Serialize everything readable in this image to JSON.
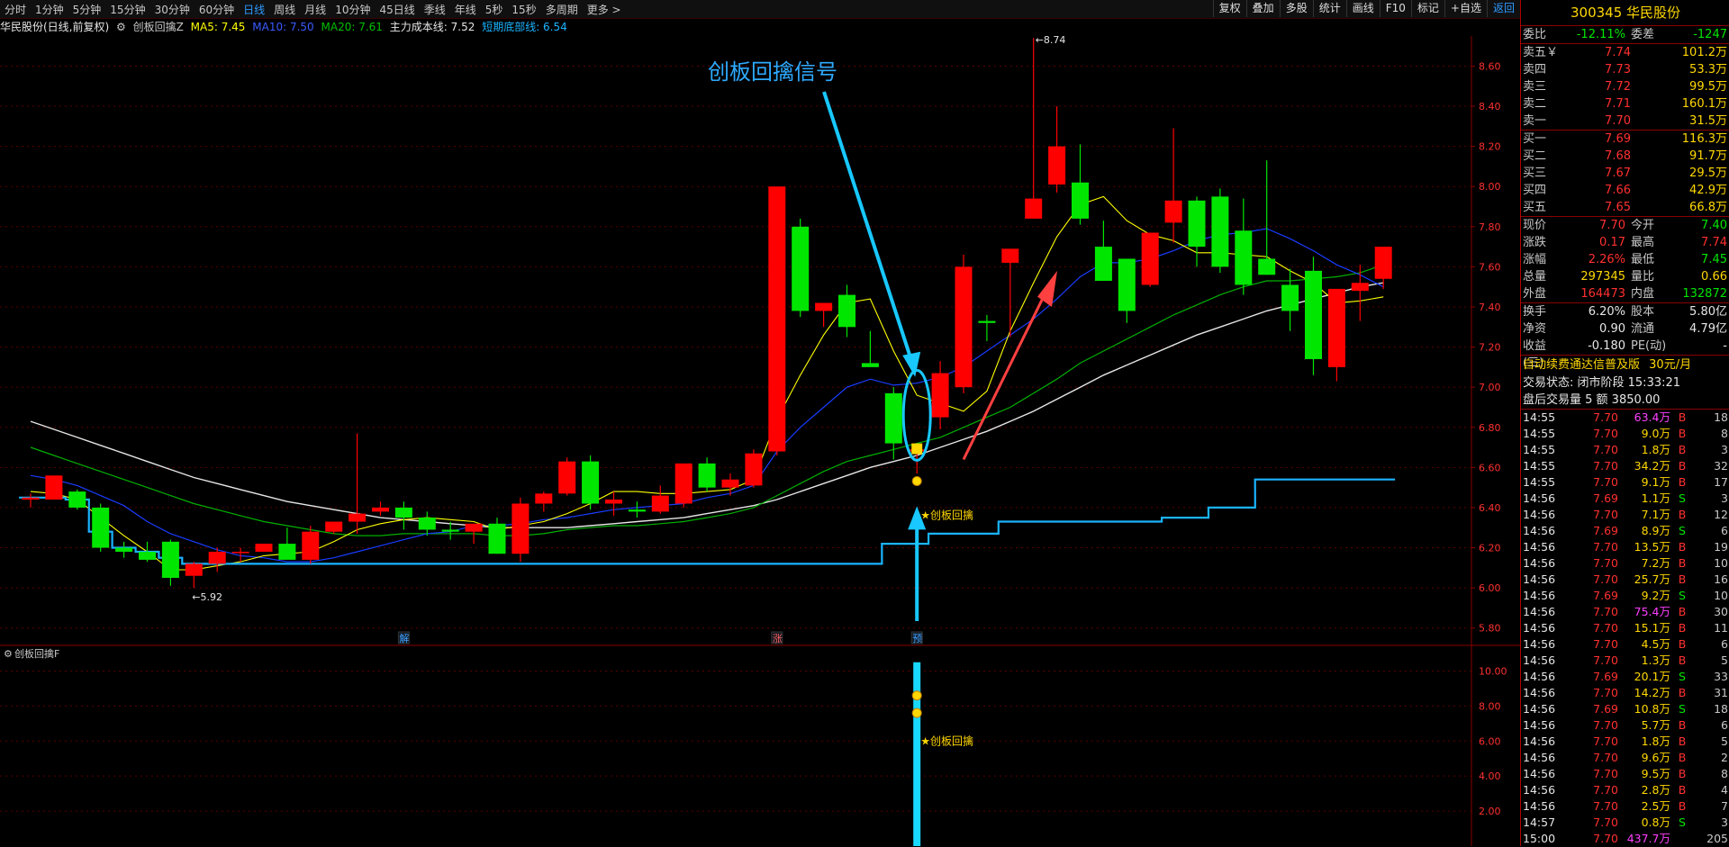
{
  "toolbar": {
    "periods": [
      "分时",
      "1分钟",
      "5分钟",
      "15分钟",
      "30分钟",
      "60分钟",
      "日线",
      "周线",
      "月线",
      "10分钟",
      "45日线",
      "季线",
      "年线",
      "5秒",
      "15秒",
      "多周期",
      "更多 >"
    ],
    "active_period": "日线",
    "right_buttons": [
      "复权",
      "叠加",
      "多股",
      "统计",
      "画线",
      "F10",
      "标记",
      "+自选",
      "返回"
    ],
    "active_right": "返回"
  },
  "info": {
    "stock": "华民股份(日线,前复权)",
    "formula": "创板回擒Z",
    "ma5": "MA5: 7.45",
    "ma10": "MA10: 7.50",
    "ma20": "MA20: 7.61",
    "cost": "主力成本线: 7.52",
    "support": "短期底部线: 6.54"
  },
  "annotation": {
    "signal_title": "创板回擒信号",
    "marker_label": "★创板回擒",
    "lower_marker_label": "★创板回擒",
    "hi_label": "8.74",
    "lo_label": "5.92",
    "bottom_tags": [
      "解",
      "涨",
      "预"
    ]
  },
  "lower_panel": {
    "title": "创板回擒F"
  },
  "colors": {
    "up": "#ff0000",
    "down": "#00e600",
    "ma5": "#ffff00",
    "ma10": "#1a3cff",
    "ma20": "#00b000",
    "cost": "#e6e6e6",
    "support": "#1ab4ff",
    "signal": "#18c8ff",
    "arrow_red": "#ff4040"
  },
  "chart_data": {
    "type": "candlestick",
    "ylim": [
      5.7,
      8.75
    ],
    "yticks": [
      "8.60",
      "8.40",
      "8.20",
      "8.00",
      "7.80",
      "7.60",
      "7.40",
      "7.20",
      "7.00",
      "6.80",
      "6.60",
      "6.40",
      "6.20",
      "6.00",
      "5.80"
    ],
    "lower_ylim": [
      0,
      11
    ],
    "lower_yticks": [
      "10.00",
      "8.00",
      "6.00",
      "4.00",
      "2.00"
    ],
    "candles": [
      [
        6.44,
        6.47,
        6.4,
        6.45
      ],
      [
        6.44,
        6.53,
        6.48,
        6.56
      ],
      [
        6.48,
        6.49,
        6.39,
        6.4
      ],
      [
        6.4,
        6.42,
        6.18,
        6.2
      ],
      [
        6.2,
        6.23,
        6.15,
        6.18
      ],
      [
        6.18,
        6.23,
        6.13,
        6.14
      ],
      [
        6.23,
        6.24,
        6.01,
        6.05
      ],
      [
        6.06,
        6.13,
        6.0,
        6.12
      ],
      [
        6.12,
        6.2,
        6.08,
        6.18
      ],
      [
        6.18,
        6.2,
        6.13,
        6.18
      ],
      [
        6.18,
        6.22,
        6.18,
        6.22
      ],
      [
        6.22,
        6.3,
        6.18,
        6.14
      ],
      [
        6.14,
        6.31,
        6.12,
        6.28
      ],
      [
        6.28,
        6.32,
        6.27,
        6.33
      ],
      [
        6.33,
        6.77,
        6.27,
        6.37
      ],
      [
        6.38,
        6.43,
        6.36,
        6.4
      ],
      [
        6.4,
        6.43,
        6.29,
        6.35
      ],
      [
        6.35,
        6.38,
        6.26,
        6.29
      ],
      [
        6.29,
        6.33,
        6.24,
        6.28
      ],
      [
        6.28,
        6.3,
        6.22,
        6.32
      ],
      [
        6.32,
        6.35,
        6.17,
        6.17
      ],
      [
        6.17,
        6.45,
        6.13,
        6.42
      ],
      [
        6.42,
        6.48,
        6.38,
        6.47
      ],
      [
        6.47,
        6.65,
        6.46,
        6.63
      ],
      [
        6.63,
        6.66,
        6.39,
        6.42
      ],
      [
        6.42,
        6.48,
        6.36,
        6.44
      ],
      [
        6.39,
        6.43,
        6.35,
        6.38
      ],
      [
        6.38,
        6.51,
        6.37,
        6.46
      ],
      [
        6.42,
        6.6,
        6.4,
        6.62
      ],
      [
        6.62,
        6.65,
        6.48,
        6.5
      ],
      [
        6.5,
        6.57,
        6.46,
        6.54
      ],
      [
        6.51,
        6.69,
        6.5,
        6.67
      ],
      [
        6.68,
        8.0,
        6.66,
        8.0
      ],
      [
        7.8,
        7.84,
        7.35,
        7.38
      ],
      [
        7.38,
        7.42,
        7.3,
        7.42
      ],
      [
        7.46,
        7.51,
        7.25,
        7.3
      ],
      [
        7.12,
        7.28,
        7.12,
        7.1
      ],
      [
        6.97,
        7.0,
        6.64,
        6.72
      ],
      [
        6.68,
        6.68,
        6.57,
        6.69
      ],
      [
        6.85,
        7.13,
        6.79,
        7.07
      ],
      [
        7.0,
        7.66,
        6.97,
        7.6
      ],
      [
        7.33,
        7.36,
        7.23,
        7.32
      ],
      [
        7.62,
        7.69,
        7.25,
        7.69
      ],
      [
        7.84,
        8.74,
        7.84,
        7.94
      ],
      [
        8.01,
        8.4,
        7.97,
        8.2
      ],
      [
        8.02,
        8.21,
        7.81,
        7.84
      ],
      [
        7.7,
        7.83,
        7.55,
        7.53
      ],
      [
        7.64,
        7.64,
        7.32,
        7.38
      ],
      [
        7.51,
        7.77,
        7.5,
        7.77
      ],
      [
        7.82,
        8.29,
        7.72,
        7.93
      ],
      [
        7.93,
        7.95,
        7.6,
        7.7
      ],
      [
        7.95,
        7.99,
        7.57,
        7.6
      ],
      [
        7.78,
        7.94,
        7.46,
        7.51
      ],
      [
        7.64,
        8.13,
        7.56,
        7.56
      ],
      [
        7.51,
        7.59,
        7.28,
        7.38
      ],
      [
        7.58,
        7.65,
        7.06,
        7.14
      ],
      [
        7.1,
        7.49,
        7.03,
        7.49
      ],
      [
        7.48,
        7.61,
        7.33,
        7.52
      ],
      [
        7.54,
        7.62,
        7.49,
        7.7
      ]
    ],
    "ma5": [
      6.48,
      6.47,
      6.44,
      6.35,
      6.26,
      6.18,
      6.09,
      6.09,
      6.11,
      6.13,
      6.16,
      6.17,
      6.18,
      6.23,
      6.29,
      6.32,
      6.34,
      6.35,
      6.34,
      6.33,
      6.29,
      6.31,
      6.33,
      6.37,
      6.42,
      6.48,
      6.48,
      6.47,
      6.47,
      6.48,
      6.49,
      6.54,
      6.84,
      7.06,
      7.26,
      7.42,
      7.44,
      7.18,
      6.96,
      6.92,
      6.88,
      6.98,
      7.28,
      7.52,
      7.75,
      7.91,
      7.95,
      7.83,
      7.76,
      7.73,
      7.67,
      7.67,
      7.66,
      7.65,
      7.58,
      7.52,
      7.42,
      7.43,
      7.45
    ],
    "ma10": [
      6.56,
      6.54,
      6.51,
      6.46,
      6.41,
      6.33,
      6.27,
      6.23,
      6.19,
      6.16,
      6.15,
      6.13,
      6.13,
      6.15,
      6.18,
      6.21,
      6.24,
      6.27,
      6.28,
      6.31,
      6.31,
      6.32,
      6.34,
      6.35,
      6.37,
      6.39,
      6.4,
      6.41,
      6.42,
      6.45,
      6.47,
      6.51,
      6.68,
      6.8,
      6.9,
      7.0,
      7.04,
      7.01,
      7.02,
      7.05,
      7.1,
      7.18,
      7.26,
      7.34,
      7.44,
      7.55,
      7.62,
      7.62,
      7.64,
      7.68,
      7.73,
      7.76,
      7.77,
      7.79,
      7.74,
      7.68,
      7.61,
      7.56,
      7.5
    ],
    "ma20": [
      6.7,
      6.66,
      6.62,
      6.58,
      6.54,
      6.5,
      6.46,
      6.42,
      6.39,
      6.36,
      6.33,
      6.31,
      6.29,
      6.27,
      6.26,
      6.26,
      6.27,
      6.27,
      6.27,
      6.27,
      6.26,
      6.26,
      6.27,
      6.29,
      6.3,
      6.31,
      6.31,
      6.32,
      6.33,
      6.35,
      6.37,
      6.4,
      6.46,
      6.52,
      6.58,
      6.63,
      6.66,
      6.69,
      6.72,
      6.75,
      6.8,
      6.85,
      6.9,
      6.97,
      7.04,
      7.12,
      7.18,
      7.24,
      7.3,
      7.36,
      7.41,
      7.46,
      7.5,
      7.53,
      7.53,
      7.54,
      7.55,
      7.57,
      7.61
    ],
    "cost": [
      6.83,
      6.79,
      6.75,
      6.71,
      6.67,
      6.63,
      6.59,
      6.55,
      6.52,
      6.49,
      6.46,
      6.43,
      6.41,
      6.39,
      6.37,
      6.35,
      6.34,
      6.33,
      6.32,
      6.31,
      6.3,
      6.3,
      6.3,
      6.3,
      6.31,
      6.32,
      6.33,
      6.34,
      6.35,
      6.37,
      6.39,
      6.41,
      6.44,
      6.48,
      6.52,
      6.56,
      6.6,
      6.63,
      6.66,
      6.7,
      6.74,
      6.78,
      6.83,
      6.88,
      6.94,
      7.0,
      7.06,
      7.11,
      7.16,
      7.21,
      7.26,
      7.3,
      7.34,
      7.38,
      7.41,
      7.44,
      7.47,
      7.5,
      7.52
    ],
    "support": [
      6.45,
      6.45,
      6.44,
      6.28,
      6.2,
      6.18,
      6.15,
      6.12,
      6.12,
      6.12,
      6.12,
      6.12,
      6.12,
      6.12,
      6.12,
      6.12,
      6.12,
      6.12,
      6.12,
      6.12,
      6.12,
      6.12,
      6.12,
      6.12,
      6.12,
      6.12,
      6.12,
      6.12,
      6.12,
      6.12,
      6.12,
      6.12,
      6.12,
      6.12,
      6.12,
      6.12,
      6.12,
      6.22,
      6.22,
      6.27,
      6.27,
      6.27,
      6.33,
      6.33,
      6.33,
      6.33,
      6.33,
      6.33,
      6.33,
      6.35,
      6.35,
      6.4,
      6.4,
      6.54,
      6.54,
      6.54,
      6.54,
      6.54,
      6.54
    ],
    "signal_index": 38,
    "lower_signal_value": 10.5
  },
  "quote": {
    "code_name": "300345 华民股份",
    "weibi": {
      "label": "委比",
      "value": "-12.11%",
      "label2": "委差",
      "value2": "-1247"
    },
    "asks": [
      {
        "label": "卖五￥",
        "price": "7.74",
        "vol": "101.2万"
      },
      {
        "label": "卖四",
        "price": "7.73",
        "vol": "53.3万"
      },
      {
        "label": "卖三",
        "price": "7.72",
        "vol": "99.5万"
      },
      {
        "label": "卖二",
        "price": "7.71",
        "vol": "160.1万"
      },
      {
        "label": "卖一",
        "price": "7.70",
        "vol": "31.5万"
      }
    ],
    "bids": [
      {
        "label": "买一",
        "price": "7.69",
        "vol": "116.3万"
      },
      {
        "label": "买二",
        "price": "7.68",
        "vol": "91.7万"
      },
      {
        "label": "买三",
        "price": "7.67",
        "vol": "29.5万"
      },
      {
        "label": "买四",
        "price": "7.66",
        "vol": "42.9万"
      },
      {
        "label": "买五",
        "price": "7.65",
        "vol": "66.8万"
      }
    ],
    "stats1": [
      {
        "l": "现价",
        "v": "7.70",
        "vc": "red",
        "l2": "今开",
        "v2": "7.40",
        "v2c": "green"
      },
      {
        "l": "涨跌",
        "v": "0.17",
        "vc": "red",
        "l2": "最高",
        "v2": "7.74",
        "v2c": "red"
      },
      {
        "l": "涨幅",
        "v": "2.26%",
        "vc": "red",
        "l2": "最低",
        "v2": "7.45",
        "v2c": "green"
      },
      {
        "l": "总量",
        "v": "297345",
        "vc": "yellow",
        "l2": "量比",
        "v2": "0.66",
        "v2c": "yellow"
      },
      {
        "l": "外盘",
        "v": "164473",
        "vc": "red",
        "l2": "内盘",
        "v2": "132872",
        "v2c": "green"
      }
    ],
    "stats2": [
      {
        "l": "换手",
        "v": "6.20%",
        "vc": "white",
        "l2": "股本",
        "v2": "5.80亿",
        "v2c": "white"
      },
      {
        "l": "净资",
        "v": "0.90",
        "vc": "white",
        "l2": "流通",
        "v2": "4.79亿",
        "v2c": "white"
      },
      {
        "l": "收益(三)",
        "v": "-0.180",
        "vc": "white",
        "l2": "PE(动)",
        "v2": "-",
        "v2c": "white"
      }
    ],
    "promo": {
      "text": "自动续费通达信普及版",
      "price": "30元/月"
    },
    "trade_status": "交易状态: 闭市阶段 15:33:21",
    "after_hours": "盘后交易量 5 额 3850.00",
    "ticks": [
      {
        "t": "14:55",
        "p": "7.70",
        "q": "63.4万",
        "bs": "B",
        "n": "18",
        "pc": "red",
        "qc": "magenta"
      },
      {
        "t": "14:55",
        "p": "7.70",
        "q": "9.0万",
        "bs": "B",
        "n": "8",
        "pc": "red",
        "qc": "yellow"
      },
      {
        "t": "14:55",
        "p": "7.70",
        "q": "1.8万",
        "bs": "B",
        "n": "3",
        "pc": "red",
        "qc": "yellow"
      },
      {
        "t": "14:55",
        "p": "7.70",
        "q": "34.2万",
        "bs": "B",
        "n": "32",
        "pc": "red",
        "qc": "yellow"
      },
      {
        "t": "14:55",
        "p": "7.70",
        "q": "9.1万",
        "bs": "B",
        "n": "17",
        "pc": "red",
        "qc": "yellow"
      },
      {
        "t": "14:56",
        "p": "7.69",
        "q": "1.1万",
        "bs": "S",
        "n": "3",
        "pc": "red",
        "qc": "yellow"
      },
      {
        "t": "14:56",
        "p": "7.70",
        "q": "7.1万",
        "bs": "B",
        "n": "12",
        "pc": "red",
        "qc": "yellow"
      },
      {
        "t": "14:56",
        "p": "7.69",
        "q": "8.9万",
        "bs": "S",
        "n": "6",
        "pc": "red",
        "qc": "yellow"
      },
      {
        "t": "14:56",
        "p": "7.70",
        "q": "13.5万",
        "bs": "B",
        "n": "19",
        "pc": "red",
        "qc": "yellow"
      },
      {
        "t": "14:56",
        "p": "7.70",
        "q": "7.2万",
        "bs": "B",
        "n": "10",
        "pc": "red",
        "qc": "yellow"
      },
      {
        "t": "14:56",
        "p": "7.70",
        "q": "25.7万",
        "bs": "B",
        "n": "16",
        "pc": "red",
        "qc": "yellow"
      },
      {
        "t": "14:56",
        "p": "7.69",
        "q": "9.2万",
        "bs": "S",
        "n": "10",
        "pc": "red",
        "qc": "yellow"
      },
      {
        "t": "14:56",
        "p": "7.70",
        "q": "75.4万",
        "bs": "B",
        "n": "30",
        "pc": "red",
        "qc": "magenta"
      },
      {
        "t": "14:56",
        "p": "7.70",
        "q": "15.1万",
        "bs": "B",
        "n": "11",
        "pc": "red",
        "qc": "yellow"
      },
      {
        "t": "14:56",
        "p": "7.70",
        "q": "4.5万",
        "bs": "B",
        "n": "6",
        "pc": "red",
        "qc": "yellow"
      },
      {
        "t": "14:56",
        "p": "7.70",
        "q": "1.3万",
        "bs": "B",
        "n": "5",
        "pc": "red",
        "qc": "yellow"
      },
      {
        "t": "14:56",
        "p": "7.69",
        "q": "20.1万",
        "bs": "S",
        "n": "33",
        "pc": "red",
        "qc": "yellow"
      },
      {
        "t": "14:56",
        "p": "7.70",
        "q": "14.2万",
        "bs": "B",
        "n": "31",
        "pc": "red",
        "qc": "yellow"
      },
      {
        "t": "14:56",
        "p": "7.69",
        "q": "10.8万",
        "bs": "S",
        "n": "18",
        "pc": "red",
        "qc": "yellow"
      },
      {
        "t": "14:56",
        "p": "7.70",
        "q": "5.7万",
        "bs": "B",
        "n": "6",
        "pc": "red",
        "qc": "yellow"
      },
      {
        "t": "14:56",
        "p": "7.70",
        "q": "1.8万",
        "bs": "B",
        "n": "5",
        "pc": "red",
        "qc": "yellow"
      },
      {
        "t": "14:56",
        "p": "7.70",
        "q": "9.6万",
        "bs": "B",
        "n": "2",
        "pc": "red",
        "qc": "yellow"
      },
      {
        "t": "14:56",
        "p": "7.70",
        "q": "9.5万",
        "bs": "B",
        "n": "8",
        "pc": "red",
        "qc": "yellow"
      },
      {
        "t": "14:56",
        "p": "7.70",
        "q": "2.8万",
        "bs": "B",
        "n": "4",
        "pc": "red",
        "qc": "yellow"
      },
      {
        "t": "14:56",
        "p": "7.70",
        "q": "2.5万",
        "bs": "B",
        "n": "7",
        "pc": "red",
        "qc": "yellow"
      },
      {
        "t": "14:57",
        "p": "7.70",
        "q": "0.8万",
        "bs": "S",
        "n": "3",
        "pc": "red",
        "qc": "yellow"
      },
      {
        "t": "15:00",
        "p": "7.70",
        "q": "437.7万",
        "bs": "",
        "n": "205",
        "pc": "red",
        "qc": "magenta"
      }
    ]
  }
}
